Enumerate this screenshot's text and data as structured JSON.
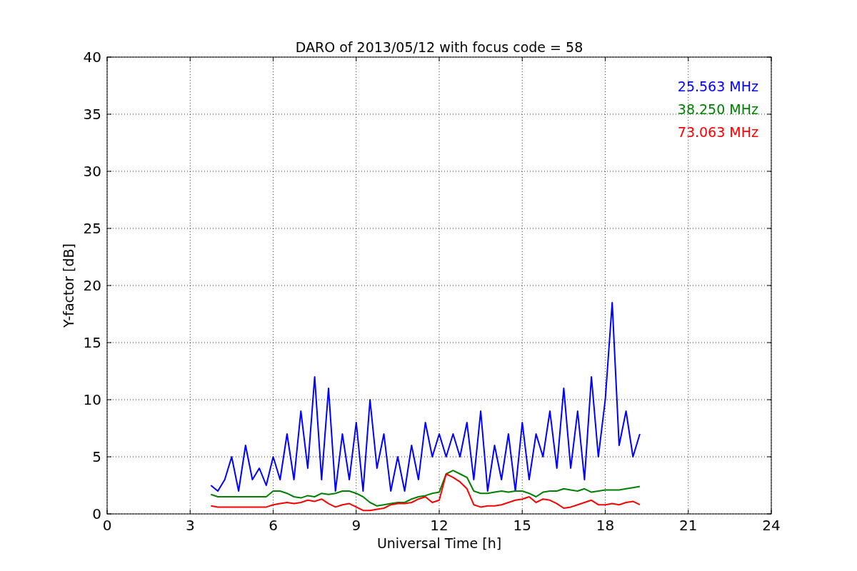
{
  "chart_data": {
    "type": "line",
    "title": "DARO of 2013/05/12 with focus code = 58",
    "xlabel": "Universal Time [h]",
    "ylabel": "Y-factor [dB]",
    "xlim": [
      0,
      24
    ],
    "ylim": [
      0,
      40
    ],
    "xticks": [
      0,
      3,
      6,
      9,
      12,
      15,
      18,
      21,
      24
    ],
    "yticks": [
      0,
      5,
      10,
      15,
      20,
      25,
      30,
      35,
      40
    ],
    "grid": true,
    "x": [
      3.75,
      4,
      4.25,
      4.5,
      4.75,
      5,
      5.25,
      5.5,
      5.75,
      6,
      6.25,
      6.5,
      6.75,
      7,
      7.25,
      7.5,
      7.75,
      8,
      8.25,
      8.5,
      8.75,
      9,
      9.25,
      9.5,
      9.75,
      10,
      10.25,
      10.5,
      10.75,
      11,
      11.25,
      11.5,
      11.75,
      12,
      12.25,
      12.5,
      12.75,
      13,
      13.25,
      13.5,
      13.75,
      14,
      14.25,
      14.5,
      14.75,
      15,
      15.25,
      15.5,
      15.75,
      16,
      16.25,
      16.5,
      16.75,
      17,
      17.25,
      17.5,
      17.75,
      18,
      18.25,
      18.5,
      18.75,
      19,
      19.25
    ],
    "series": [
      {
        "name": "25.563 MHz",
        "color": "#0000ff",
        "values": [
          2.5,
          2,
          3,
          5,
          2,
          6,
          3,
          4,
          2.5,
          5,
          3,
          7,
          3,
          9,
          4,
          12,
          3,
          11,
          2,
          7,
          3,
          8,
          2,
          10,
          4,
          7,
          2,
          5,
          2,
          6,
          3,
          8,
          5,
          7,
          5,
          7,
          5,
          8,
          3,
          9,
          2,
          6,
          3,
          7,
          2,
          8,
          3,
          7,
          5,
          9,
          4,
          11,
          4,
          9,
          3,
          12,
          5,
          10,
          18.5,
          6,
          9,
          5,
          7
        ]
      },
      {
        "name": "38.250 MHz",
        "color": "#008000",
        "values": [
          1.7,
          1.5,
          1.5,
          1.5,
          1.5,
          1.5,
          1.5,
          1.5,
          1.5,
          2,
          2,
          1.8,
          1.5,
          1.4,
          1.6,
          1.5,
          1.8,
          1.7,
          1.8,
          2,
          2,
          1.8,
          1.5,
          1,
          0.7,
          0.8,
          0.9,
          1,
          1,
          1.3,
          1.5,
          1.6,
          1.8,
          1.9,
          3.5,
          3.8,
          3.5,
          3.2,
          2,
          1.8,
          1.8,
          1.9,
          2,
          1.9,
          2,
          2,
          1.8,
          1.5,
          1.9,
          2,
          2,
          2.2,
          2.1,
          2,
          2.2,
          1.9,
          2,
          2.1,
          2.1,
          2.1,
          2.2,
          2.3,
          2.4
        ]
      },
      {
        "name": "73.063 MHz",
        "color": "#ff0000",
        "values": [
          0.7,
          0.6,
          0.6,
          0.6,
          0.6,
          0.6,
          0.6,
          0.6,
          0.6,
          0.8,
          0.9,
          1,
          0.9,
          1,
          1.2,
          1.1,
          1.3,
          0.9,
          0.6,
          0.8,
          0.9,
          0.6,
          0.3,
          0.3,
          0.4,
          0.5,
          0.8,
          0.9,
          0.9,
          1,
          1.3,
          1.5,
          1,
          1.2,
          3.5,
          3.2,
          2.8,
          2.2,
          0.8,
          0.6,
          0.7,
          0.7,
          0.8,
          1,
          1.2,
          1.3,
          1.5,
          1,
          1.3,
          1.2,
          0.9,
          0.5,
          0.6,
          0.8,
          1,
          1.2,
          0.8,
          0.8,
          0.9,
          0.8,
          1,
          1.1,
          0.8
        ]
      }
    ]
  }
}
